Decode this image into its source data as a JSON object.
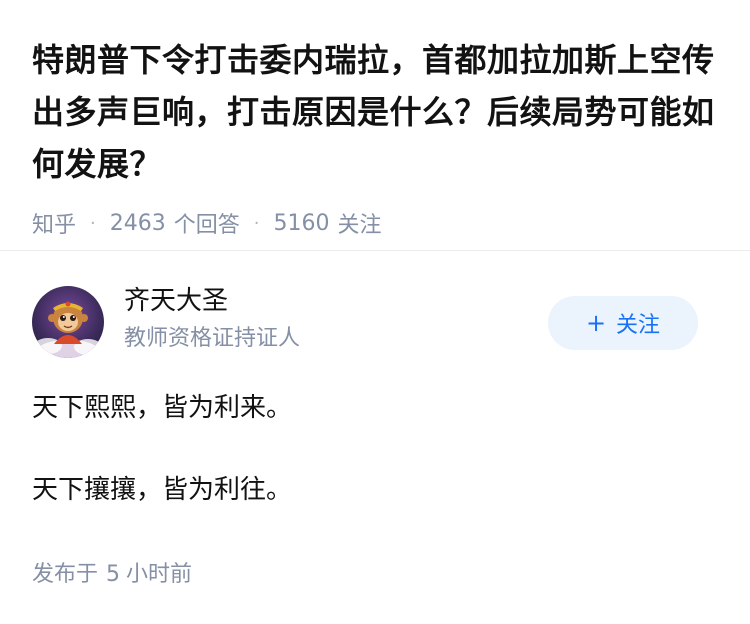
{
  "question": {
    "title": "特朗普下令打击委内瑞拉，首都加拉加斯上空传出多声巨响，打击原因是什么？后续局势可能如何发展？",
    "source": "知乎",
    "answer_count": "2463",
    "answer_count_label": "个回答",
    "follower_count": "5160",
    "follower_count_label": "关注"
  },
  "answer": {
    "author": {
      "name": "齐天大圣",
      "badge": "教师资格证持证人",
      "avatar_icon": "monkey-king-avatar"
    },
    "follow_button": {
      "plus": "+",
      "label": "关注"
    },
    "paragraphs": [
      "天下熙熙，皆为利来。",
      "天下攘攘，皆为利往。"
    ],
    "published": {
      "prefix": "发布于",
      "value": "5",
      "unit": "小时前"
    }
  },
  "colors": {
    "text": "#121212",
    "meta": "#8590a6",
    "accent": "#1772f6",
    "follow_bg": "#ebf3fd"
  }
}
